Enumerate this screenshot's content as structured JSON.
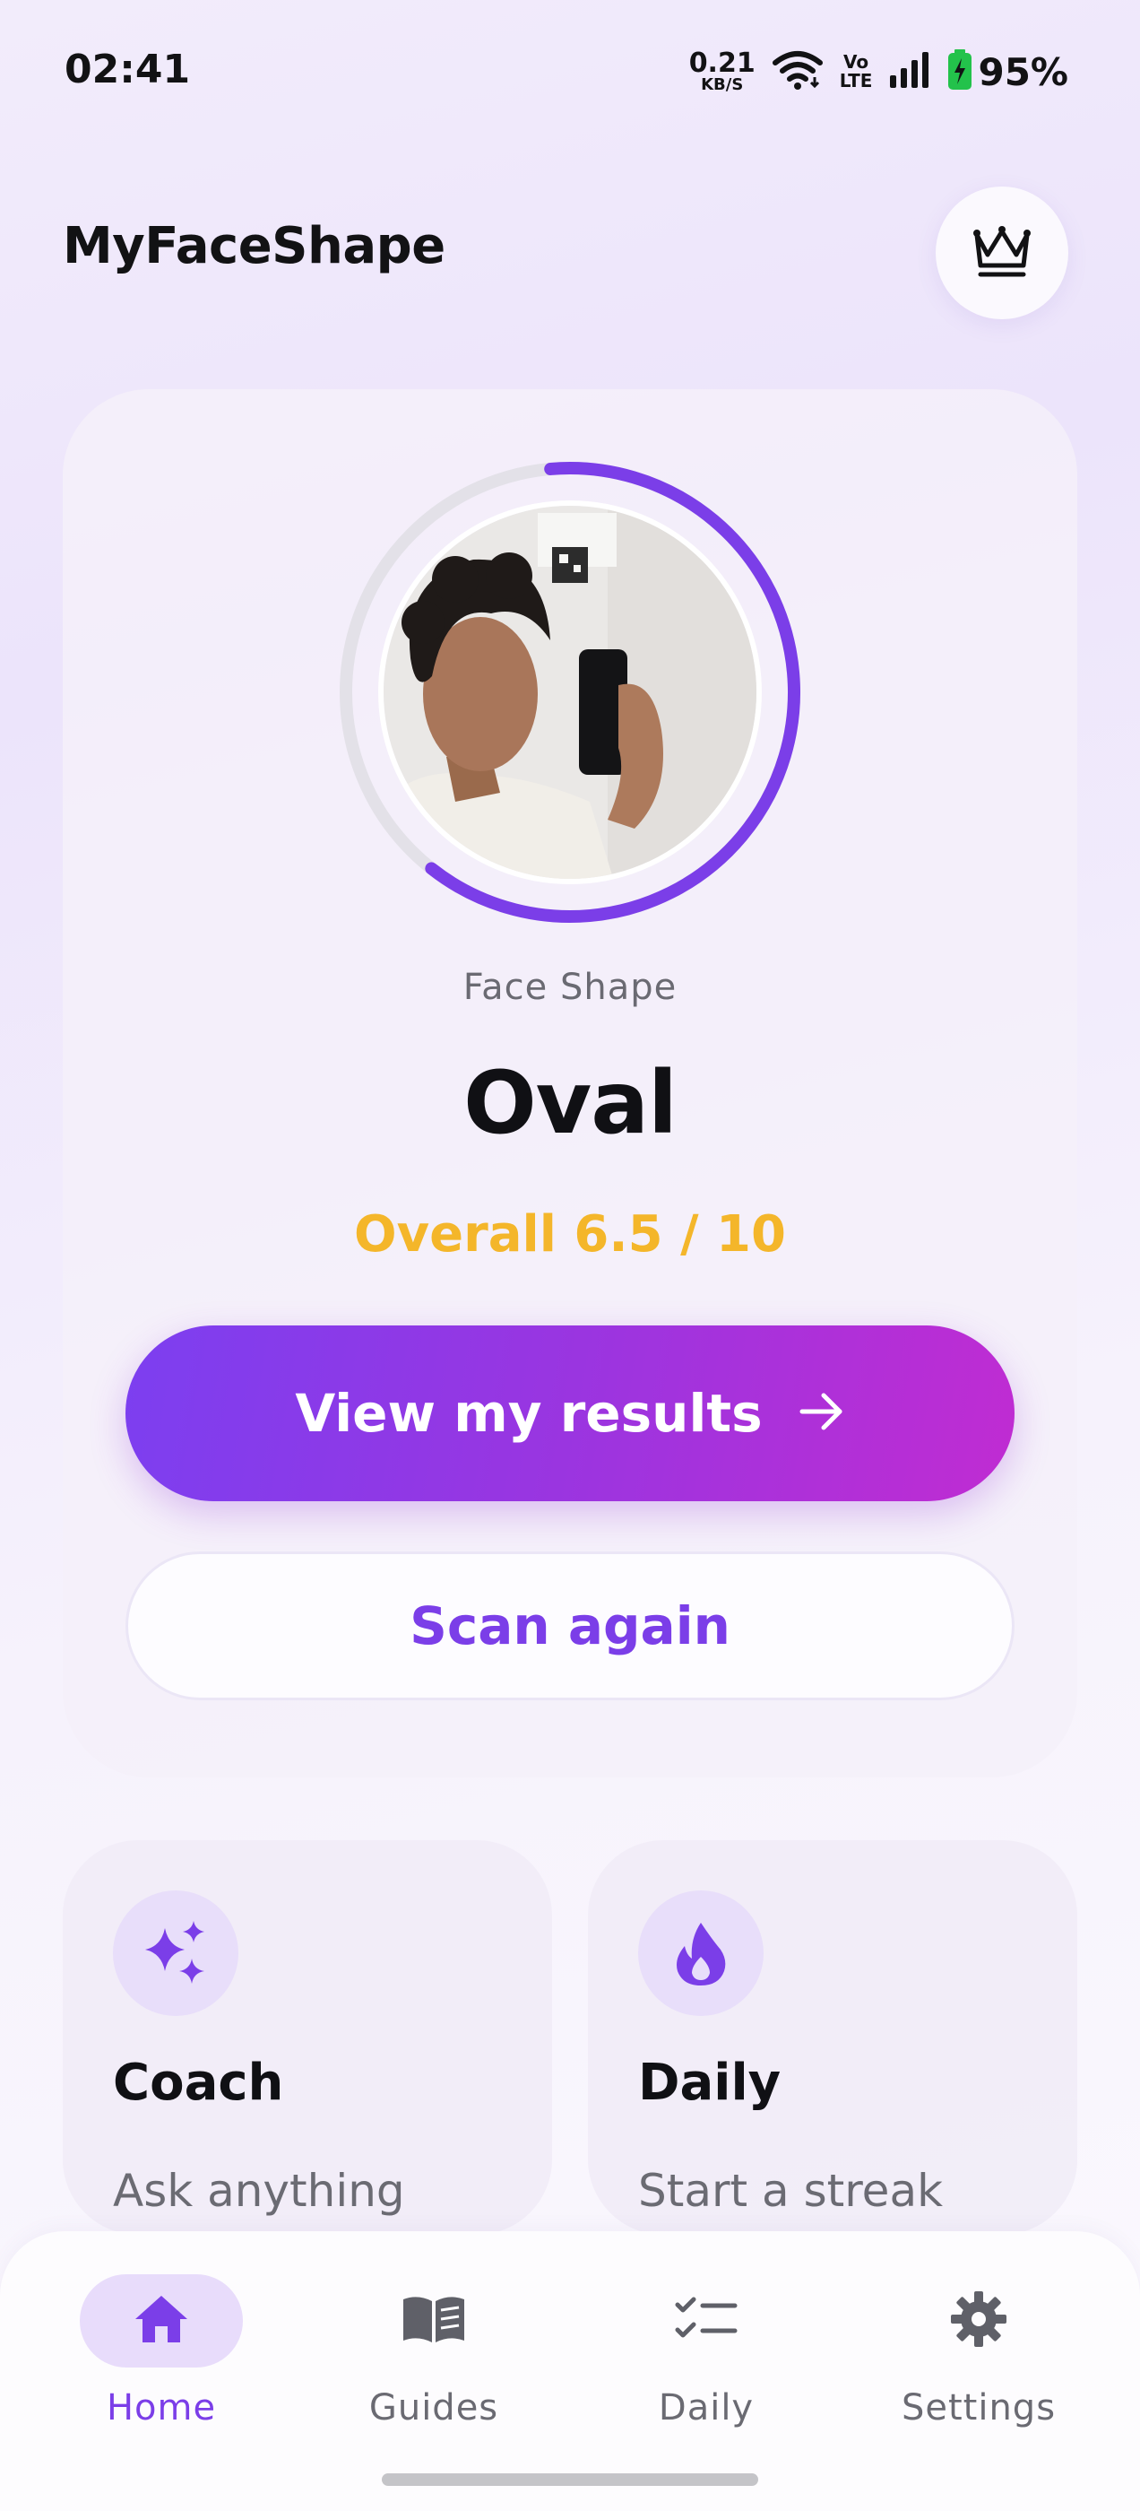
{
  "status_bar": {
    "time": "02:41",
    "net_speed_value": "0.21",
    "net_speed_unit": "KB/S",
    "volte_top": "Vo",
    "volte_bottom": "LTE",
    "battery": "95%"
  },
  "header": {
    "title": "MyFaceShape",
    "premium_icon": "crown-icon"
  },
  "result_card": {
    "progress": 0.62,
    "face_label": "Face Shape",
    "face_shape": "Oval",
    "overall": "Overall 6.5 / 10",
    "primary_button": "View my results",
    "secondary_button": "Scan again"
  },
  "features": [
    {
      "title": "Coach",
      "subtitle": "Ask anything",
      "icon": "sparkles-icon"
    },
    {
      "title": "Daily",
      "subtitle": "Start a streak",
      "icon": "flame-icon"
    }
  ],
  "bottom_nav": [
    {
      "label": "Home",
      "icon": "home-icon",
      "active": true
    },
    {
      "label": "Guides",
      "icon": "book-icon",
      "active": false
    },
    {
      "label": "Daily",
      "icon": "checklist-icon",
      "active": false
    },
    {
      "label": "Settings",
      "icon": "gear-icon",
      "active": false
    }
  ],
  "colors": {
    "accent": "#7b3ee8",
    "gradient_start": "#7c3ff0",
    "gradient_end": "#c02cd2",
    "score": "#f4b62a"
  }
}
